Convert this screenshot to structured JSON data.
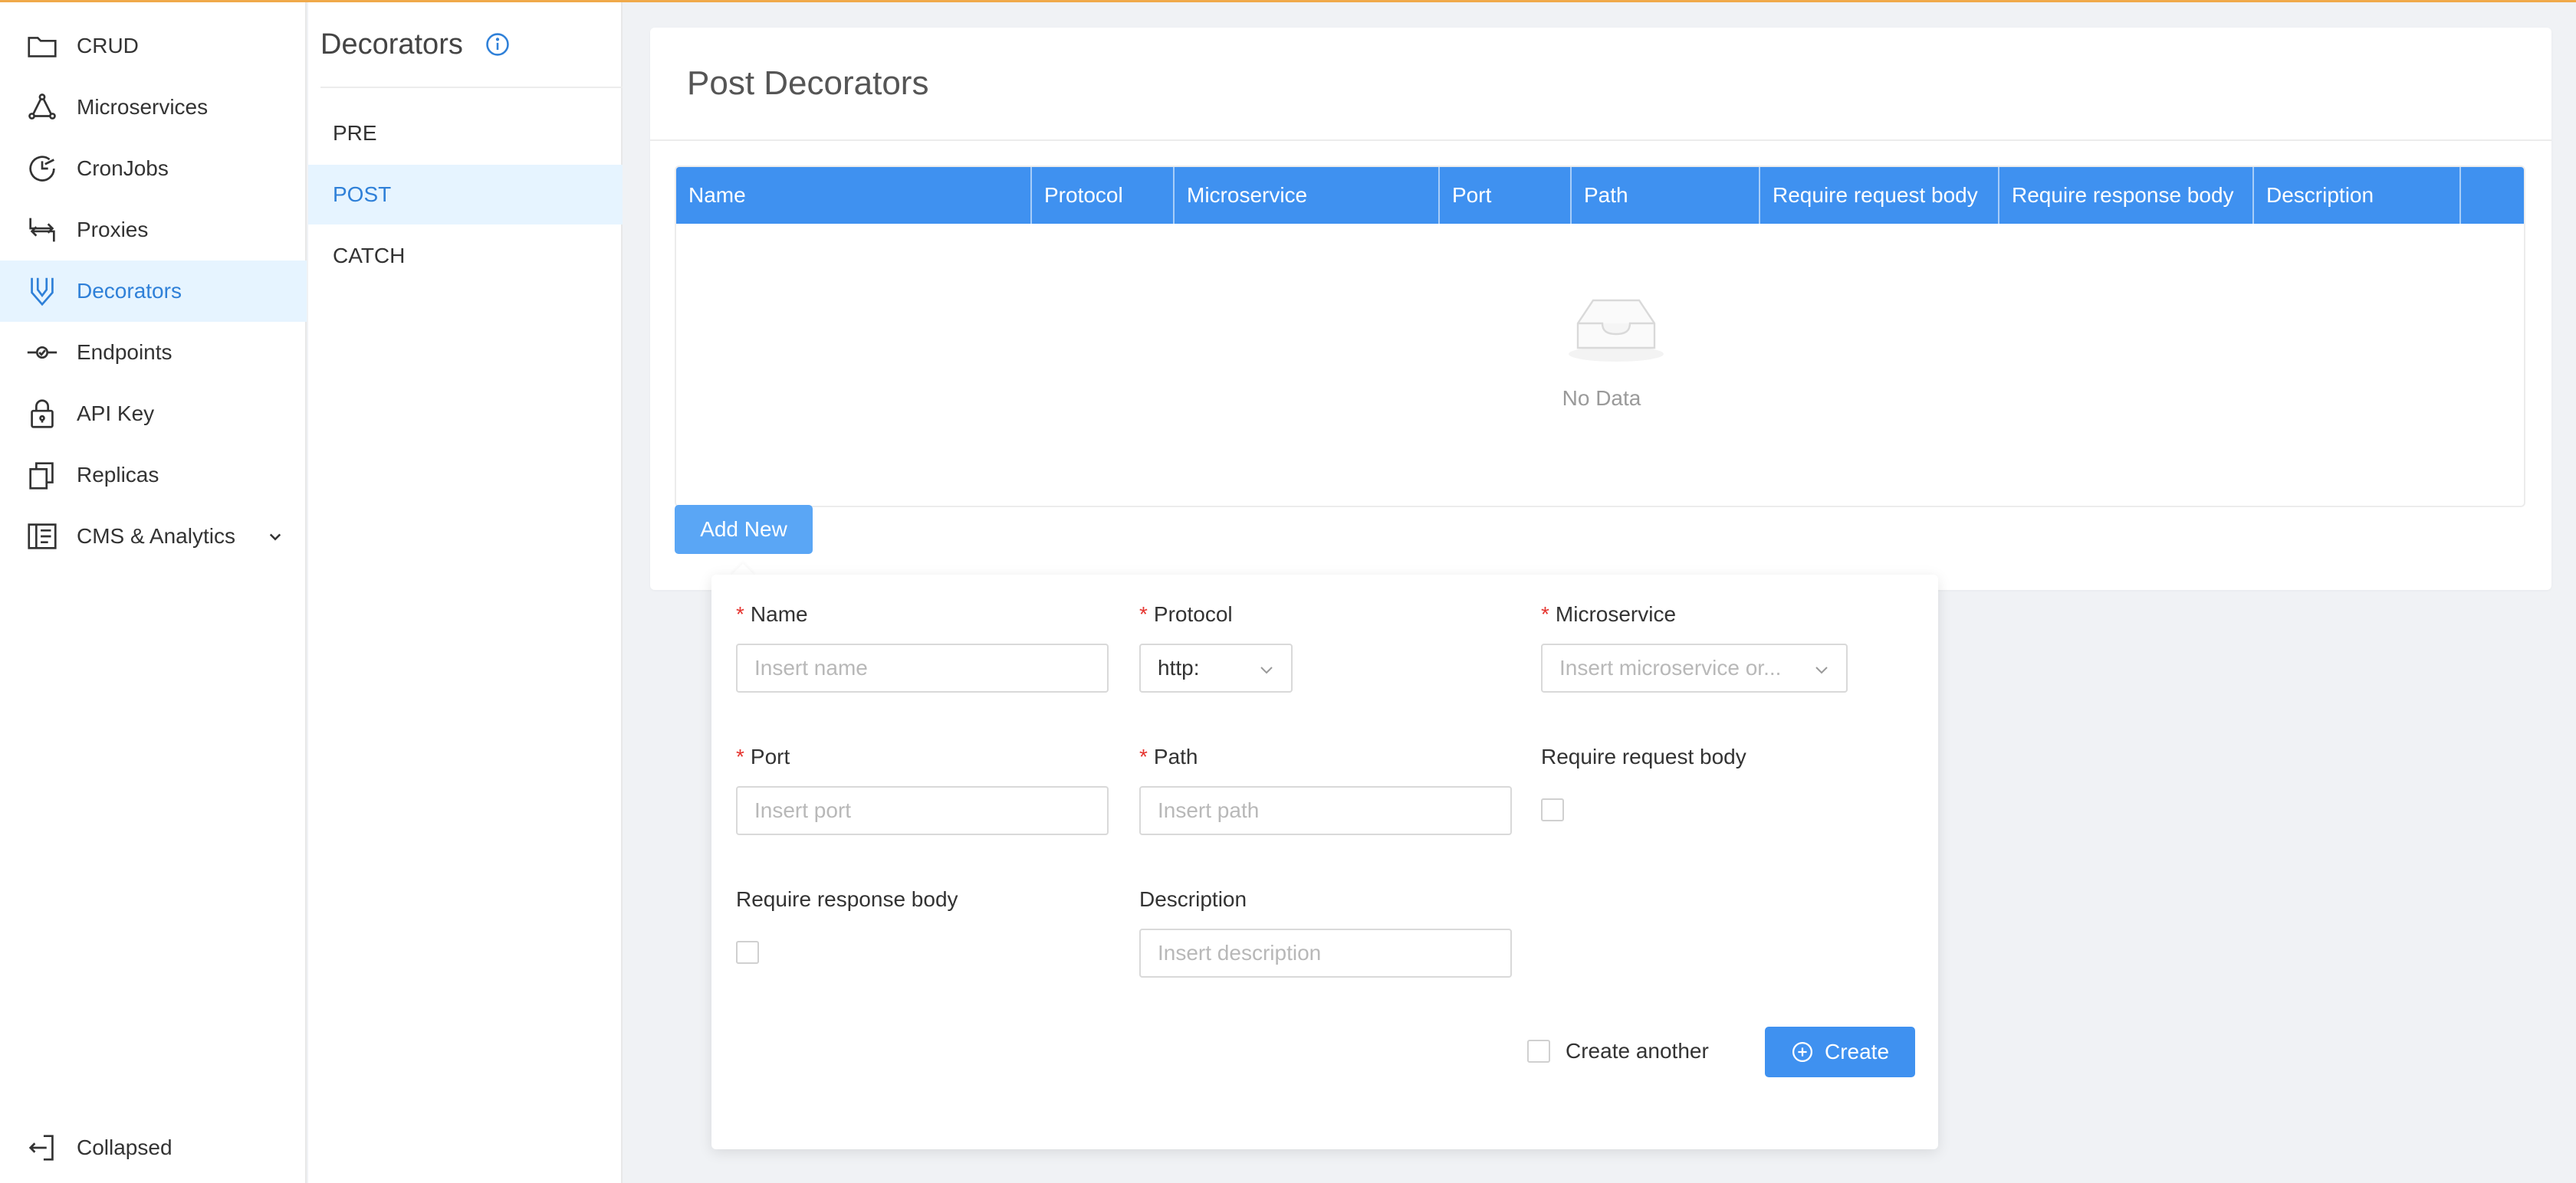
{
  "sidebar": {
    "items": [
      {
        "label": "CRUD",
        "icon": "folder-icon"
      },
      {
        "label": "Microservices",
        "icon": "microservices-icon"
      },
      {
        "label": "CronJobs",
        "icon": "clock-icon"
      },
      {
        "label": "Proxies",
        "icon": "proxy-icon"
      },
      {
        "label": "Decorators",
        "icon": "decorator-icon",
        "active": true
      },
      {
        "label": "Endpoints",
        "icon": "endpoint-icon"
      },
      {
        "label": "API Key",
        "icon": "lock-icon"
      },
      {
        "label": "Replicas",
        "icon": "copy-icon"
      },
      {
        "label": "CMS & Analytics",
        "icon": "cms-icon"
      }
    ],
    "collapsed_label": "Collapsed"
  },
  "subnav": {
    "title": "Decorators",
    "items": [
      "PRE",
      "POST",
      "CATCH"
    ],
    "active": "POST"
  },
  "main": {
    "title": "Post Decorators",
    "columns": [
      "Name",
      "Protocol",
      "Microservice",
      "Port",
      "Path",
      "Require request body",
      "Require response body",
      "Description",
      ""
    ],
    "empty_text": "No Data",
    "add_button": "Add New"
  },
  "form": {
    "name_label": "Name",
    "name_placeholder": "Insert name",
    "protocol_label": "Protocol",
    "protocol_value": "http:",
    "microservice_label": "Microservice",
    "microservice_placeholder": "Insert microservice or...",
    "port_label": "Port",
    "port_placeholder": "Insert port",
    "path_label": "Path",
    "path_placeholder": "Insert path",
    "req_body_label": "Require request body",
    "res_body_label": "Require response body",
    "description_label": "Description",
    "description_placeholder": "Insert description",
    "create_another_label": "Create another",
    "create_button": "Create",
    "required_mark": "*"
  },
  "colors": {
    "accent": "#3f91f0",
    "active_bg": "#e6f4ff",
    "active_text": "#2f80d8",
    "top_line": "#f0a94a",
    "required": "#e5342f"
  }
}
